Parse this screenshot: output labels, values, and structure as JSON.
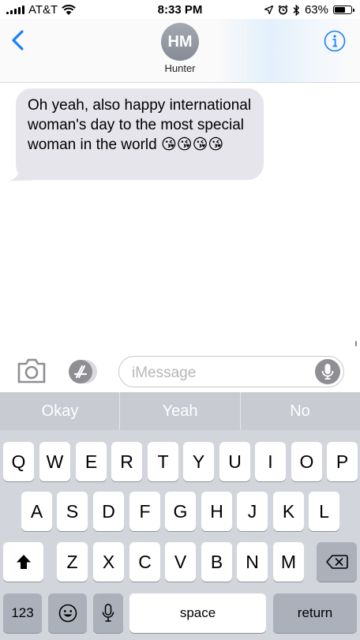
{
  "status_bar": {
    "carrier": "AT&T",
    "time": "8:33 PM",
    "battery_percent": "63%",
    "battery_level": 0.63
  },
  "header": {
    "avatar_initials": "HM",
    "contact_name": "Hunter"
  },
  "messages": [
    {
      "direction": "received",
      "text": "Oh yeah, also happy international woman's day to the most special woman in the world 😘😘😘😘"
    }
  ],
  "input": {
    "placeholder": "iMessage"
  },
  "keyboard": {
    "suggestions": [
      "Okay",
      "Yeah",
      "No"
    ],
    "row1": [
      "Q",
      "W",
      "E",
      "R",
      "T",
      "Y",
      "U",
      "I",
      "O",
      "P"
    ],
    "row2": [
      "A",
      "S",
      "D",
      "F",
      "G",
      "H",
      "J",
      "K",
      "L"
    ],
    "row3": [
      "Z",
      "X",
      "C",
      "V",
      "B",
      "N",
      "M"
    ],
    "numbers_label": "123",
    "space_label": "space",
    "return_label": "return"
  },
  "icons": {
    "back": "chevron-left-icon",
    "info": "info-icon",
    "camera": "camera-icon",
    "apps": "app-store-icon",
    "mic": "microphone-icon",
    "shift": "shift-icon",
    "delete": "delete-icon",
    "emoji": "emoji-icon",
    "dictation": "microphone-icon",
    "location": "location-icon",
    "alarm": "alarm-icon",
    "bluetooth": "bluetooth-icon",
    "wifi": "wifi-icon"
  },
  "colors": {
    "accent": "#1a7ffb",
    "received_bubble": "#e6e5eb",
    "keyboard_bg": "#d2d5db"
  }
}
